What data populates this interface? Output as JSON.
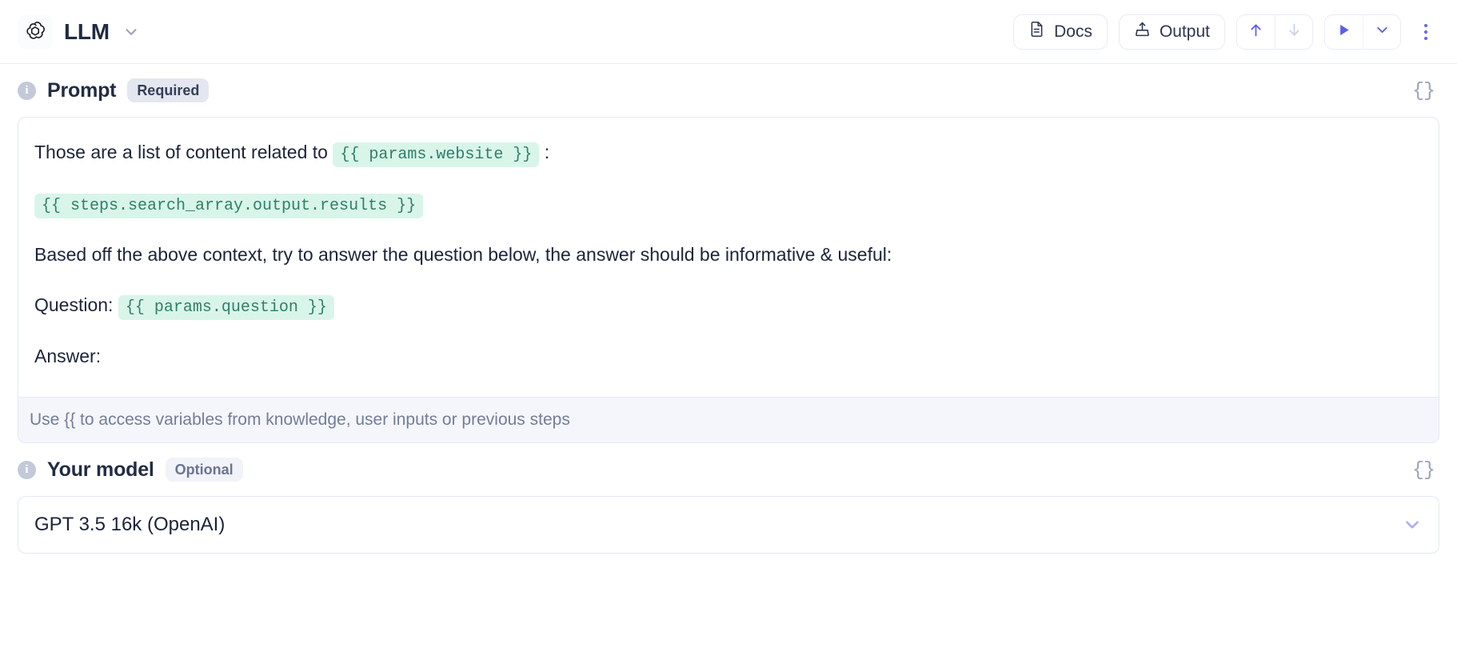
{
  "header": {
    "logo_icon": "openai-logo-icon",
    "title": "LLM",
    "title_caret_icon": "chevron-down-icon",
    "docs_button": {
      "label": "Docs",
      "icon": "document-icon"
    },
    "output_button": {
      "label": "Output",
      "icon": "export-upload-icon"
    },
    "nav_up": {
      "icon": "arrow-up-icon",
      "state": "enabled"
    },
    "nav_down": {
      "icon": "arrow-down-icon",
      "state": "disabled"
    },
    "run_button": {
      "icon": "play-icon"
    },
    "run_caret": {
      "icon": "chevron-down-icon"
    },
    "more_menu": {
      "icon": "kebab-menu-icon"
    }
  },
  "accent": {
    "indigo": "#5b5fe9",
    "indigo_muted": "#a7aef5",
    "chip_bg": "#d9f5ea",
    "chip_text": "#2f7f68",
    "border": "#e3e7f7"
  },
  "prompt_section": {
    "info_icon": "info-icon",
    "title": "Prompt",
    "badge": "Required",
    "braces_icon": "curly-braces-icon",
    "lines": [
      {
        "parts": [
          {
            "type": "text",
            "value": "Those are a list of content related to "
          },
          {
            "type": "chip",
            "value": "{{ params.website }}"
          },
          {
            "type": "text",
            "value": " :"
          }
        ]
      },
      {
        "parts": [
          {
            "type": "chip",
            "value": "{{ steps.search_array.output.results }}"
          }
        ]
      },
      {
        "parts": [
          {
            "type": "text",
            "value": "Based off the above context, try to answer the question below, the answer should be informative & useful:"
          }
        ]
      },
      {
        "parts": [
          {
            "type": "text",
            "value": "Question: "
          },
          {
            "type": "chip",
            "value": "{{ params.question }}"
          }
        ]
      },
      {
        "parts": [
          {
            "type": "text",
            "value": "Answer:"
          }
        ]
      }
    ],
    "hint": "Use {{ to access variables from knowledge, user inputs or previous steps"
  },
  "model_section": {
    "info_icon": "info-icon",
    "title": "Your model",
    "badge": "Optional",
    "braces_icon": "curly-braces-icon",
    "selected_value": "GPT 3.5 16k (OpenAI)",
    "caret_icon": "chevron-down-icon"
  }
}
